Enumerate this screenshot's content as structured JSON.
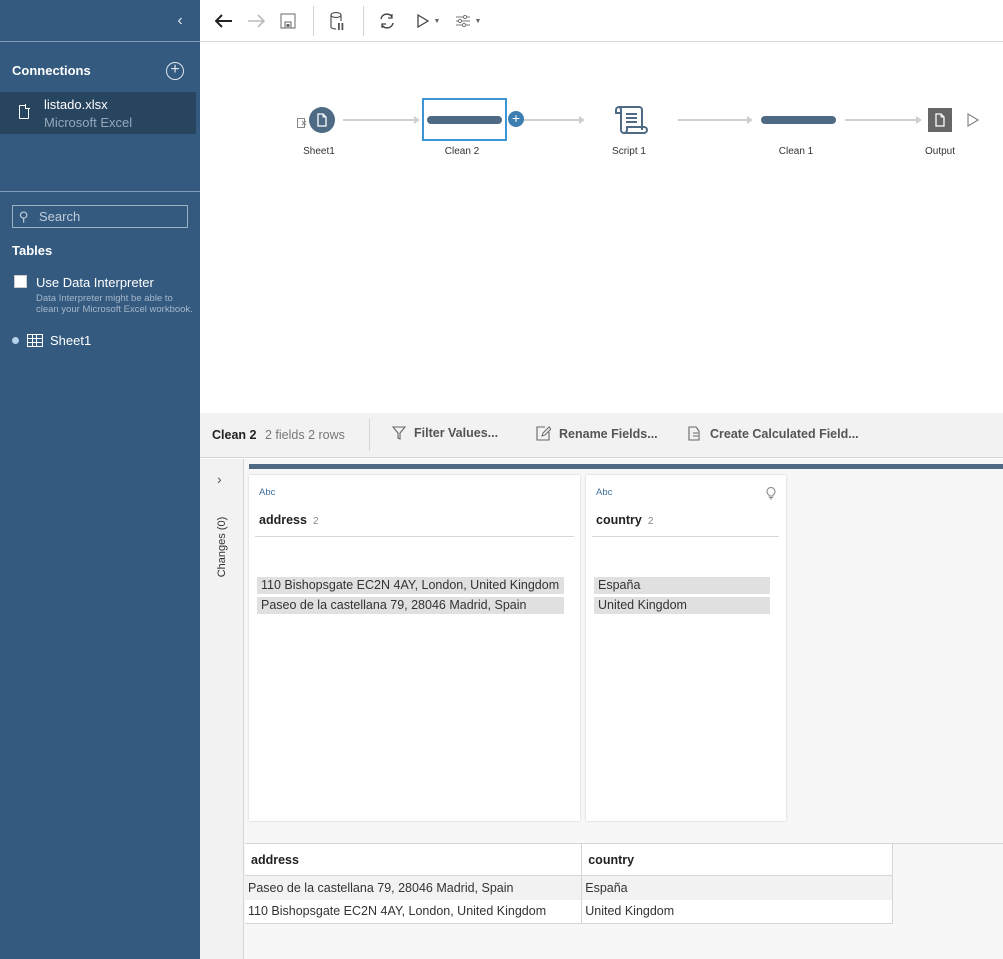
{
  "sidebar": {
    "connections_title": "Connections",
    "connections": [
      {
        "name": "listado.xlsx",
        "type": "Microsoft Excel"
      }
    ],
    "search_placeholder": "Search",
    "tables_title": "Tables",
    "data_interpreter": {
      "label": "Use Data Interpreter",
      "checked": false,
      "help": "Data Interpreter might be able to clean your Microsoft Excel workbook."
    },
    "tables": [
      {
        "name": "Sheet1"
      }
    ]
  },
  "toolbar": {
    "icons": [
      "back-icon",
      "forward-icon",
      "save-icon",
      "data-pause-icon",
      "refresh-icon",
      "run-icon",
      "settings-sliders-icon"
    ]
  },
  "flow": {
    "nodes": [
      {
        "label": "Sheet1",
        "kind": "input"
      },
      {
        "label": "Clean 2",
        "kind": "clean",
        "selected": true
      },
      {
        "label": "Script 1",
        "kind": "script"
      },
      {
        "label": "Clean 1",
        "kind": "clean"
      },
      {
        "label": "Output",
        "kind": "output"
      }
    ]
  },
  "profile": {
    "step_name": "Clean 2",
    "meta": "2 fields  2 rows",
    "actions": [
      {
        "label": "Filter Values...",
        "icon": "filter-icon"
      },
      {
        "label": "Rename Fields...",
        "icon": "rename-icon"
      },
      {
        "label": "Create Calculated Field...",
        "icon": "calculated-field-icon"
      }
    ],
    "changes_label": "Changes (0)",
    "fields": [
      {
        "type": "Abc",
        "name": "address",
        "count": "2",
        "values": [
          "110 Bishopsgate EC2N 4AY, London, United Kingdom",
          "Paseo de la castellana 79, 28046 Madrid, Spain"
        ]
      },
      {
        "type": "Abc",
        "name": "country",
        "count": "2",
        "values": [
          "España",
          "United Kingdom"
        ]
      }
    ]
  },
  "grid": {
    "columns": [
      "address",
      "country"
    ],
    "rows": [
      [
        "Paseo de la castellana 79, 28046 Madrid, Spain",
        "España"
      ],
      [
        "110 Bishopsgate EC2N 4AY, London, United Kingdom",
        "United Kingdom"
      ]
    ]
  },
  "colors": {
    "sidebar_bg": "#345a80",
    "selected_connection_bg": "#284560",
    "clean_bar": "#4e6a84",
    "selection_border": "#3d95d6",
    "type_label": "#41729a"
  }
}
